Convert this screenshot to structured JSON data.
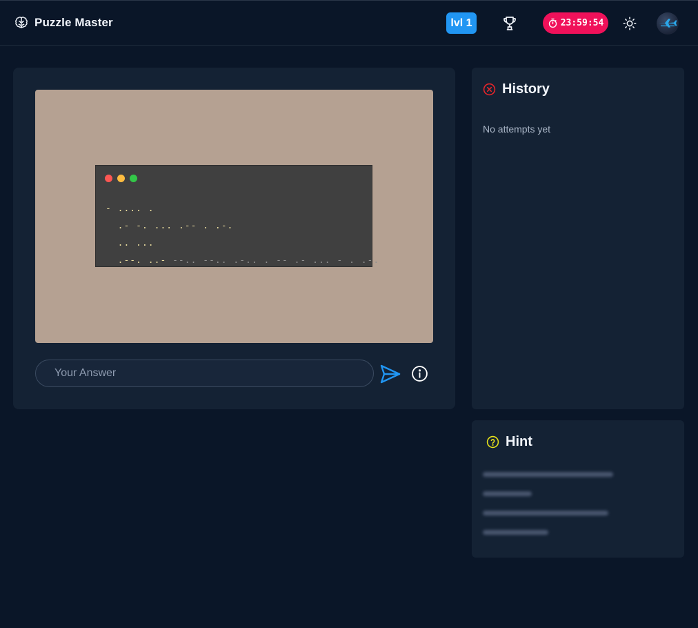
{
  "header": {
    "brand_name": "Puzzle Master",
    "level_label": "lvl 1",
    "timer": "23:59:54"
  },
  "puzzle": {
    "code_lines": [
      "- .... .",
      "  .- -. ... .-- . .-.",
      "  .. ...",
      "  .--. ..-"
    ],
    "code_dim_tail": " --.. --.. .-.. . -- .- ... - . .-."
  },
  "answer": {
    "placeholder": "Your Answer"
  },
  "history": {
    "title": "History",
    "empty_text": "No attempts yet"
  },
  "hint": {
    "title": "Hint"
  },
  "colors": {
    "background": "#0a1628",
    "card": "#142234",
    "accent_blue": "#2196f3",
    "timer_pink": "#f0115a",
    "history_icon_red": "#e5252a",
    "hint_icon_yellow": "#e7e21a",
    "puzzle_frame": "#b5a192",
    "terminal_bg": "#404040"
  },
  "icons": {
    "brand": "brain-icon",
    "trophy": "trophy-icon",
    "timer": "stopwatch-icon",
    "theme": "sun-icon",
    "send": "send-icon",
    "info": "info-icon",
    "history": "x-circle-icon",
    "hint": "question-circle-icon"
  }
}
